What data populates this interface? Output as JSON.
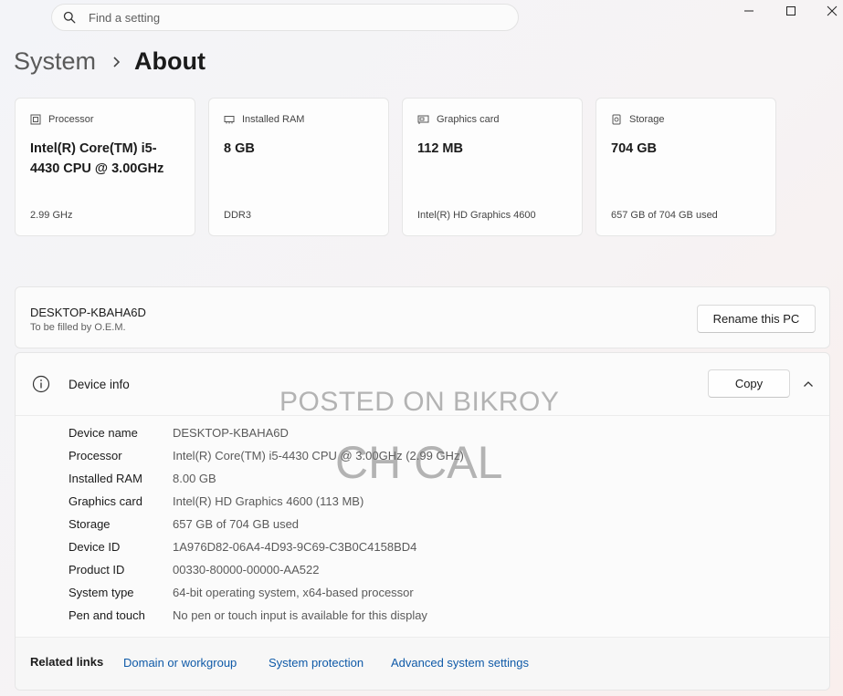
{
  "search": {
    "placeholder": "Find a setting",
    "icon": "search-icon"
  },
  "breadcrumb": {
    "parent": "System",
    "current": "About"
  },
  "specs_cards": [
    {
      "icon": "processor-icon",
      "label": "Processor",
      "value": "Intel(R) Core(TM) i5-4430 CPU @ 3.00GHz",
      "sub": "2.99 GHz"
    },
    {
      "icon": "ram-icon",
      "label": "Installed RAM",
      "value": "8 GB",
      "sub": "DDR3"
    },
    {
      "icon": "graphics-card-icon",
      "label": "Graphics card",
      "value": "112 MB",
      "sub": "Intel(R) HD Graphics 4600"
    },
    {
      "icon": "storage-icon",
      "label": "Storage",
      "value": "704 GB",
      "sub": "657 GB of 704 GB used"
    }
  ],
  "pc": {
    "name": "DESKTOP-KBAHA6D",
    "subtitle": "To be filled by O.E.M.",
    "rename_label": "Rename this PC"
  },
  "device_info": {
    "title": "Device info",
    "copy_label": "Copy",
    "rows": [
      {
        "key": "Device name",
        "value": "DESKTOP-KBAHA6D"
      },
      {
        "key": "Processor",
        "value": "Intel(R) Core(TM) i5-4430 CPU @ 3.00GHz (2.99 GHz)"
      },
      {
        "key": "Installed RAM",
        "value": "8.00 GB"
      },
      {
        "key": "Graphics card",
        "value": "Intel(R) HD Graphics 4600 (113 MB)"
      },
      {
        "key": "Storage",
        "value": "657 GB of 704 GB used"
      },
      {
        "key": "Device ID",
        "value": "1A976D82-06A4-4D93-9C69-C3B0C4158BD4"
      },
      {
        "key": "Product ID",
        "value": "00330-80000-00000-AA522"
      },
      {
        "key": "System type",
        "value": "64-bit operating system, x64-based processor"
      },
      {
        "key": "Pen and touch",
        "value": "No pen or touch input is available for this display"
      }
    ]
  },
  "related_links": {
    "label": "Related links",
    "links": [
      "Domain or workgroup",
      "System protection",
      "Advanced system settings"
    ]
  },
  "watermark": {
    "line1": "POSTED ON BIKROY",
    "line2": "CH CAL"
  },
  "colors": {
    "link": "#0f5aa8",
    "card_bg": "#fdfdfd"
  }
}
